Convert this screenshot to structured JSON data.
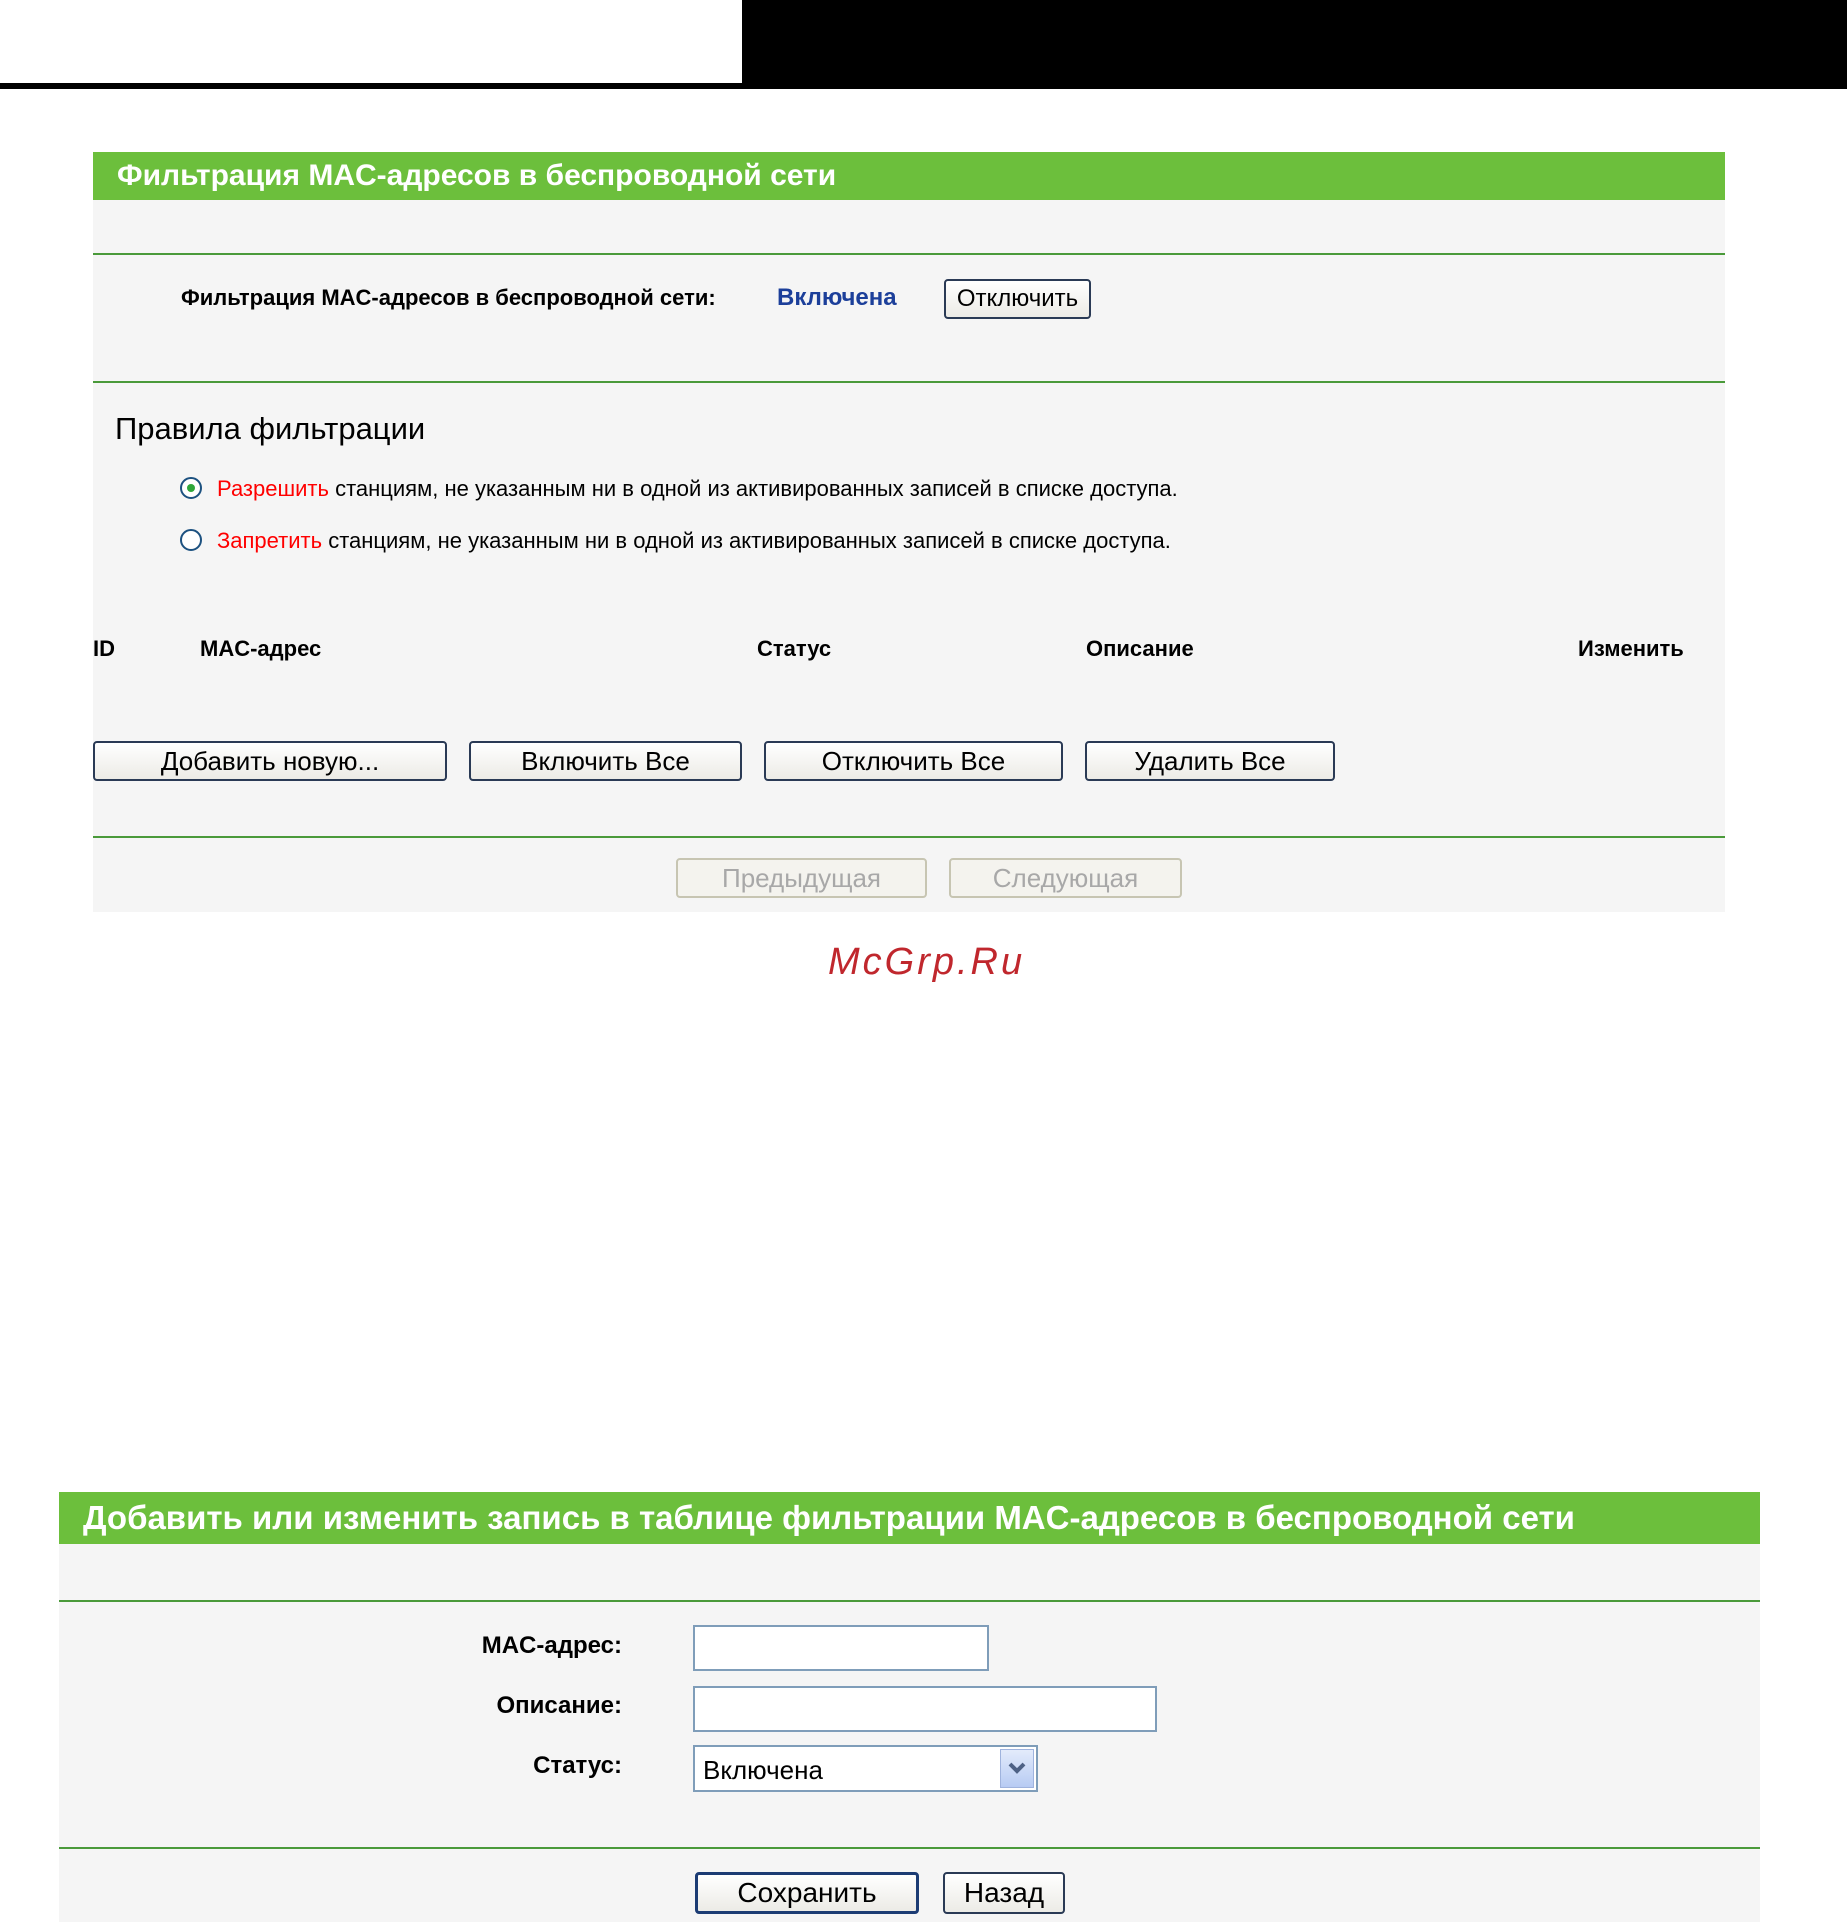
{
  "filter_panel": {
    "title": "Фильтрация MAC-адресов в беспроводной сети",
    "status_label": "Фильтрация MAC-адресов в беспроводной сети:",
    "status_value": "Включена",
    "toggle_button": "Отключить",
    "rules_heading": "Правила фильтрации",
    "rules": [
      {
        "keyword": "Разрешить",
        "text": " станциям, не указанным ни в одной из активированных записей в списке доступа.",
        "selected": true
      },
      {
        "keyword": "Запретить",
        "text": " станциям, не указанным ни в одной из активированных записей в списке доступа.",
        "selected": false
      }
    ],
    "table_headers": {
      "id": "ID",
      "mac": "MAC-адрес",
      "status": "Статус",
      "description": "Описание",
      "edit": "Изменить"
    },
    "buttons": {
      "add_new": "Добавить новую...",
      "enable_all": "Включить Все",
      "disable_all": "Отключить Все",
      "delete_all": "Удалить Все",
      "prev": "Предыдущая",
      "next": "Следующая"
    }
  },
  "watermark": "McGrp.Ru",
  "edit_panel": {
    "title": "Добавить или изменить запись в таблице фильтрации MAC-адресов в беспроводной сети",
    "mac_label": "MAC-адрес:",
    "mac_value": "",
    "desc_label": "Описание:",
    "desc_value": "",
    "status_label": "Статус:",
    "status_value": "Включена",
    "save_button": "Сохранить",
    "back_button": "Назад"
  },
  "colors": {
    "header_green": "#6cbf3c",
    "status_blue": "#1c3f9a",
    "keyword_red": "#ff0000",
    "watermark_red": "#c0272d"
  }
}
